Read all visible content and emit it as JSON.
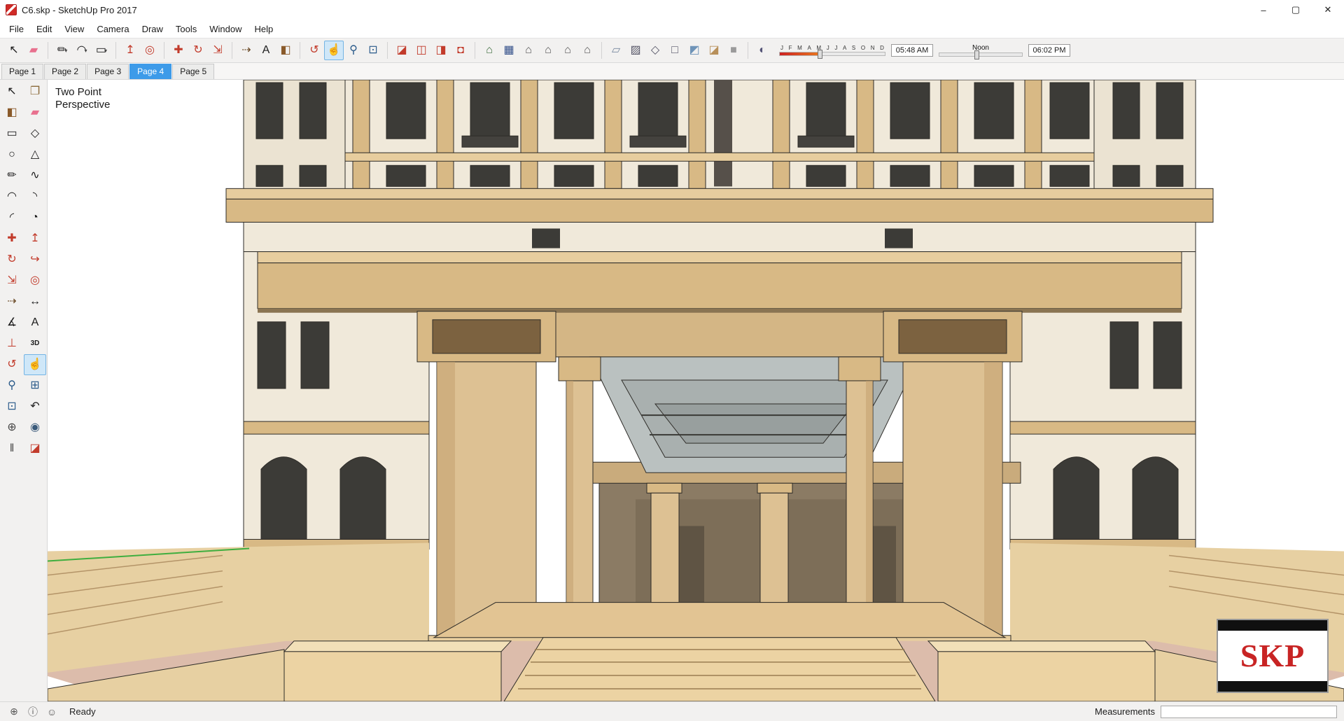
{
  "window": {
    "title": "C6.skp - SketchUp Pro 2017",
    "controls": [
      {
        "name": "minimize",
        "glyph": "–"
      },
      {
        "name": "maximize",
        "glyph": "▢"
      },
      {
        "name": "close",
        "glyph": "✕"
      }
    ]
  },
  "menu": {
    "items": [
      "File",
      "Edit",
      "View",
      "Camera",
      "Draw",
      "Tools",
      "Window",
      "Help"
    ]
  },
  "toolbar": {
    "groups": [
      [
        {
          "name": "select",
          "glyph": "↖",
          "color": "#1c1c1c"
        },
        {
          "name": "eraser",
          "glyph": "▰",
          "color": "#e8708e"
        }
      ],
      [
        {
          "name": "line",
          "glyph": "✏",
          "color": "#1c1c1c",
          "dropdown": true
        },
        {
          "name": "arc",
          "glyph": "◠",
          "color": "#1c1c1c",
          "dropdown": true
        },
        {
          "name": "shapes",
          "glyph": "▭",
          "color": "#1c1c1c",
          "dropdown": true
        }
      ],
      [
        {
          "name": "push-pull",
          "glyph": "↥",
          "color": "#c23b2b"
        },
        {
          "name": "offset",
          "glyph": "◎",
          "color": "#c23b2b"
        }
      ],
      [
        {
          "name": "move",
          "glyph": "✚",
          "color": "#c23b2b"
        },
        {
          "name": "rotate",
          "glyph": "↻",
          "color": "#c23b2b"
        },
        {
          "name": "scale",
          "glyph": "⇲",
          "color": "#c23b2b"
        }
      ],
      [
        {
          "name": "tape-measure",
          "glyph": "⇢",
          "color": "#6b4a26"
        },
        {
          "name": "text",
          "glyph": "A",
          "color": "#1c1c1c"
        },
        {
          "name": "paint-bucket",
          "glyph": "◧",
          "color": "#8a5a2a"
        }
      ],
      [
        {
          "name": "orbit",
          "glyph": "↺",
          "color": "#c23b2b"
        },
        {
          "name": "pan",
          "glyph": "☝",
          "color": "#c89a5e",
          "active": true
        },
        {
          "name": "zoom",
          "glyph": "⚲",
          "color": "#2a5a8a"
        },
        {
          "name": "zoom-extents",
          "glyph": "⊡",
          "color": "#2a5a8a"
        }
      ],
      [
        {
          "name": "section-plane",
          "glyph": "◪",
          "color": "#c23b2b"
        },
        {
          "name": "display-section-planes",
          "glyph": "◫",
          "color": "#c23b2b"
        },
        {
          "name": "display-section-cuts",
          "glyph": "◨",
          "color": "#c23b2b"
        },
        {
          "name": "display-section-fill",
          "glyph": "◘",
          "color": "#c23b2b"
        }
      ],
      [
        {
          "name": "view-iso",
          "glyph": "⌂",
          "color": "#3a6a3a"
        },
        {
          "name": "view-top",
          "glyph": "▦",
          "color": "#34508a"
        },
        {
          "name": "view-front",
          "glyph": "⌂",
          "color": "#555555"
        },
        {
          "name": "view-right",
          "glyph": "⌂",
          "color": "#555555"
        },
        {
          "name": "view-back",
          "glyph": "⌂",
          "color": "#555555"
        },
        {
          "name": "view-left",
          "glyph": "⌂",
          "color": "#555555"
        }
      ],
      [
        {
          "name": "style-xray",
          "glyph": "▱",
          "color": "#7a8aa0"
        },
        {
          "name": "style-back-edges",
          "glyph": "▨",
          "color": "#555566"
        },
        {
          "name": "style-wireframe",
          "glyph": "◇",
          "color": "#555566"
        },
        {
          "name": "style-hidden-line",
          "glyph": "□",
          "color": "#555566"
        },
        {
          "name": "style-shaded",
          "glyph": "◩",
          "color": "#6f94b8"
        },
        {
          "name": "style-shaded-with-textures",
          "glyph": "◪",
          "color": "#b8905a"
        },
        {
          "name": "style-monochrome",
          "glyph": "■",
          "color": "#9a9a9a"
        }
      ],
      [
        {
          "name": "shadows-toggle",
          "glyph": "◐",
          "color": "#555577"
        }
      ]
    ],
    "shadow": {
      "months": [
        "J",
        "F",
        "M",
        "A",
        "M",
        "J",
        "J",
        "A",
        "S",
        "O",
        "N",
        "D"
      ],
      "date_slider_pos": 0.38,
      "time_start": "05:48 AM",
      "noon_label": "Noon",
      "time_end": "06:02 PM",
      "time_slider_pos": 0.45
    }
  },
  "tabs": [
    {
      "label": "Page 1",
      "active": false
    },
    {
      "label": "Page 2",
      "active": false
    },
    {
      "label": "Page 3",
      "active": false
    },
    {
      "label": "Page 4",
      "active": true
    },
    {
      "label": "Page 5",
      "active": false
    }
  ],
  "palette": {
    "tools": [
      {
        "name": "select",
        "glyph": "↖",
        "color": "#1c1c1c"
      },
      {
        "name": "make-component",
        "glyph": "❐",
        "color": "#8a6a3a"
      },
      {
        "name": "paint-bucket",
        "glyph": "◧",
        "color": "#8a5a2a"
      },
      {
        "name": "eraser",
        "glyph": "▰",
        "color": "#e8708e"
      },
      {
        "name": "rectangle",
        "glyph": "▭",
        "color": "#1c1c1c"
      },
      {
        "name": "rotated-rectangle",
        "glyph": "◇",
        "color": "#1c1c1c"
      },
      {
        "name": "circle",
        "glyph": "○",
        "color": "#1c1c1c"
      },
      {
        "name": "polygon",
        "glyph": "△",
        "color": "#1c1c1c"
      },
      {
        "name": "line",
        "glyph": "✏",
        "color": "#1c1c1c"
      },
      {
        "name": "freehand",
        "glyph": "∿",
        "color": "#1c1c1c"
      },
      {
        "name": "arc",
        "glyph": "◠",
        "color": "#1c1c1c"
      },
      {
        "name": "two-point-arc",
        "glyph": "◝",
        "color": "#1c1c1c"
      },
      {
        "name": "three-point-arc",
        "glyph": "◜",
        "color": "#1c1c1c"
      },
      {
        "name": "pie",
        "glyph": "◔",
        "color": "#1c1c1c"
      },
      {
        "name": "move",
        "glyph": "✚",
        "color": "#c23b2b"
      },
      {
        "name": "push-pull",
        "glyph": "↥",
        "color": "#c23b2b"
      },
      {
        "name": "rotate",
        "glyph": "↻",
        "color": "#c23b2b"
      },
      {
        "name": "follow-me",
        "glyph": "↪",
        "color": "#c23b2b"
      },
      {
        "name": "scale",
        "glyph": "⇲",
        "color": "#c23b2b"
      },
      {
        "name": "offset",
        "glyph": "◎",
        "color": "#c23b2b"
      },
      {
        "name": "tape-measure",
        "glyph": "⇢",
        "color": "#6b4a26"
      },
      {
        "name": "dimension",
        "glyph": "↔",
        "color": "#1c1c1c"
      },
      {
        "name": "protractor",
        "glyph": "∡",
        "color": "#1c1c1c"
      },
      {
        "name": "text",
        "glyph": "A",
        "color": "#1c1c1c"
      },
      {
        "name": "axes",
        "glyph": "⊥",
        "color": "#c23b2b"
      },
      {
        "name": "three-d-text",
        "glyph": "3D",
        "color": "#1c1c1c"
      },
      {
        "name": "orbit",
        "glyph": "↺",
        "color": "#c23b2b"
      },
      {
        "name": "pan",
        "glyph": "☝",
        "color": "#c89a5e",
        "active": true
      },
      {
        "name": "zoom",
        "glyph": "⚲",
        "color": "#2a5a8a"
      },
      {
        "name": "zoom-window",
        "glyph": "⊞",
        "color": "#2a5a8a"
      },
      {
        "name": "zoom-extents",
        "glyph": "⊡",
        "color": "#2a5a8a"
      },
      {
        "name": "previous",
        "glyph": "↶",
        "color": "#1c1c1c"
      },
      {
        "name": "position-camera",
        "glyph": "⊕",
        "color": "#444444"
      },
      {
        "name": "look-around",
        "glyph": "◉",
        "color": "#3a5a7a"
      },
      {
        "name": "walk",
        "glyph": "‖",
        "color": "#444444"
      },
      {
        "name": "section-plane",
        "glyph": "◪",
        "color": "#c23b2b"
      }
    ]
  },
  "viewport": {
    "camera_label_line1": "Two Point",
    "camera_label_line2": "Perspective",
    "watermark_text": "SKP"
  },
  "statusbar": {
    "icons": [
      {
        "name": "geolocation",
        "glyph": "⊕"
      },
      {
        "name": "credits",
        "glyph": "ⓘ"
      },
      {
        "name": "sign-in",
        "glyph": "☺"
      }
    ],
    "status_text": "Ready",
    "measurements_label": "Measurements",
    "measurements_value": ""
  },
  "colors": {
    "accent": "#3d9be9",
    "tool_active_bg": "#cfe7f8",
    "tool_active_border": "#74b4e4",
    "logo_red": "#d02b27",
    "facade_cream": "#f0e9da",
    "tower_cream": "#ebe3d2",
    "trim_tan": "#d8b985",
    "trim_tan_light": "#e7cd9e",
    "trim_shadow": "#8a7452",
    "column_beige": "#ddc193",
    "column_shade": "#c2a170",
    "capital_dark": "#7c6240",
    "window_dark": "#3c3b37",
    "ceiling_gray_1": "#bac1c0",
    "ceiling_gray_2": "#a9b0af",
    "ceiling_gray_3": "#989f9e",
    "interior_dark": "#8b7b64",
    "interior_dark_2": "#7d6e58",
    "lintel_tan": "#c9ab7c",
    "ground_pink": "#dcbcab",
    "steps_tan": "#ecd3a3",
    "terrace_tan": "#e7d0a2",
    "platform_tan": "#e2c493",
    "plinth_top": "#f2e0b8",
    "edge": "#2e2c28",
    "green_axis": "#3fae3f"
  }
}
